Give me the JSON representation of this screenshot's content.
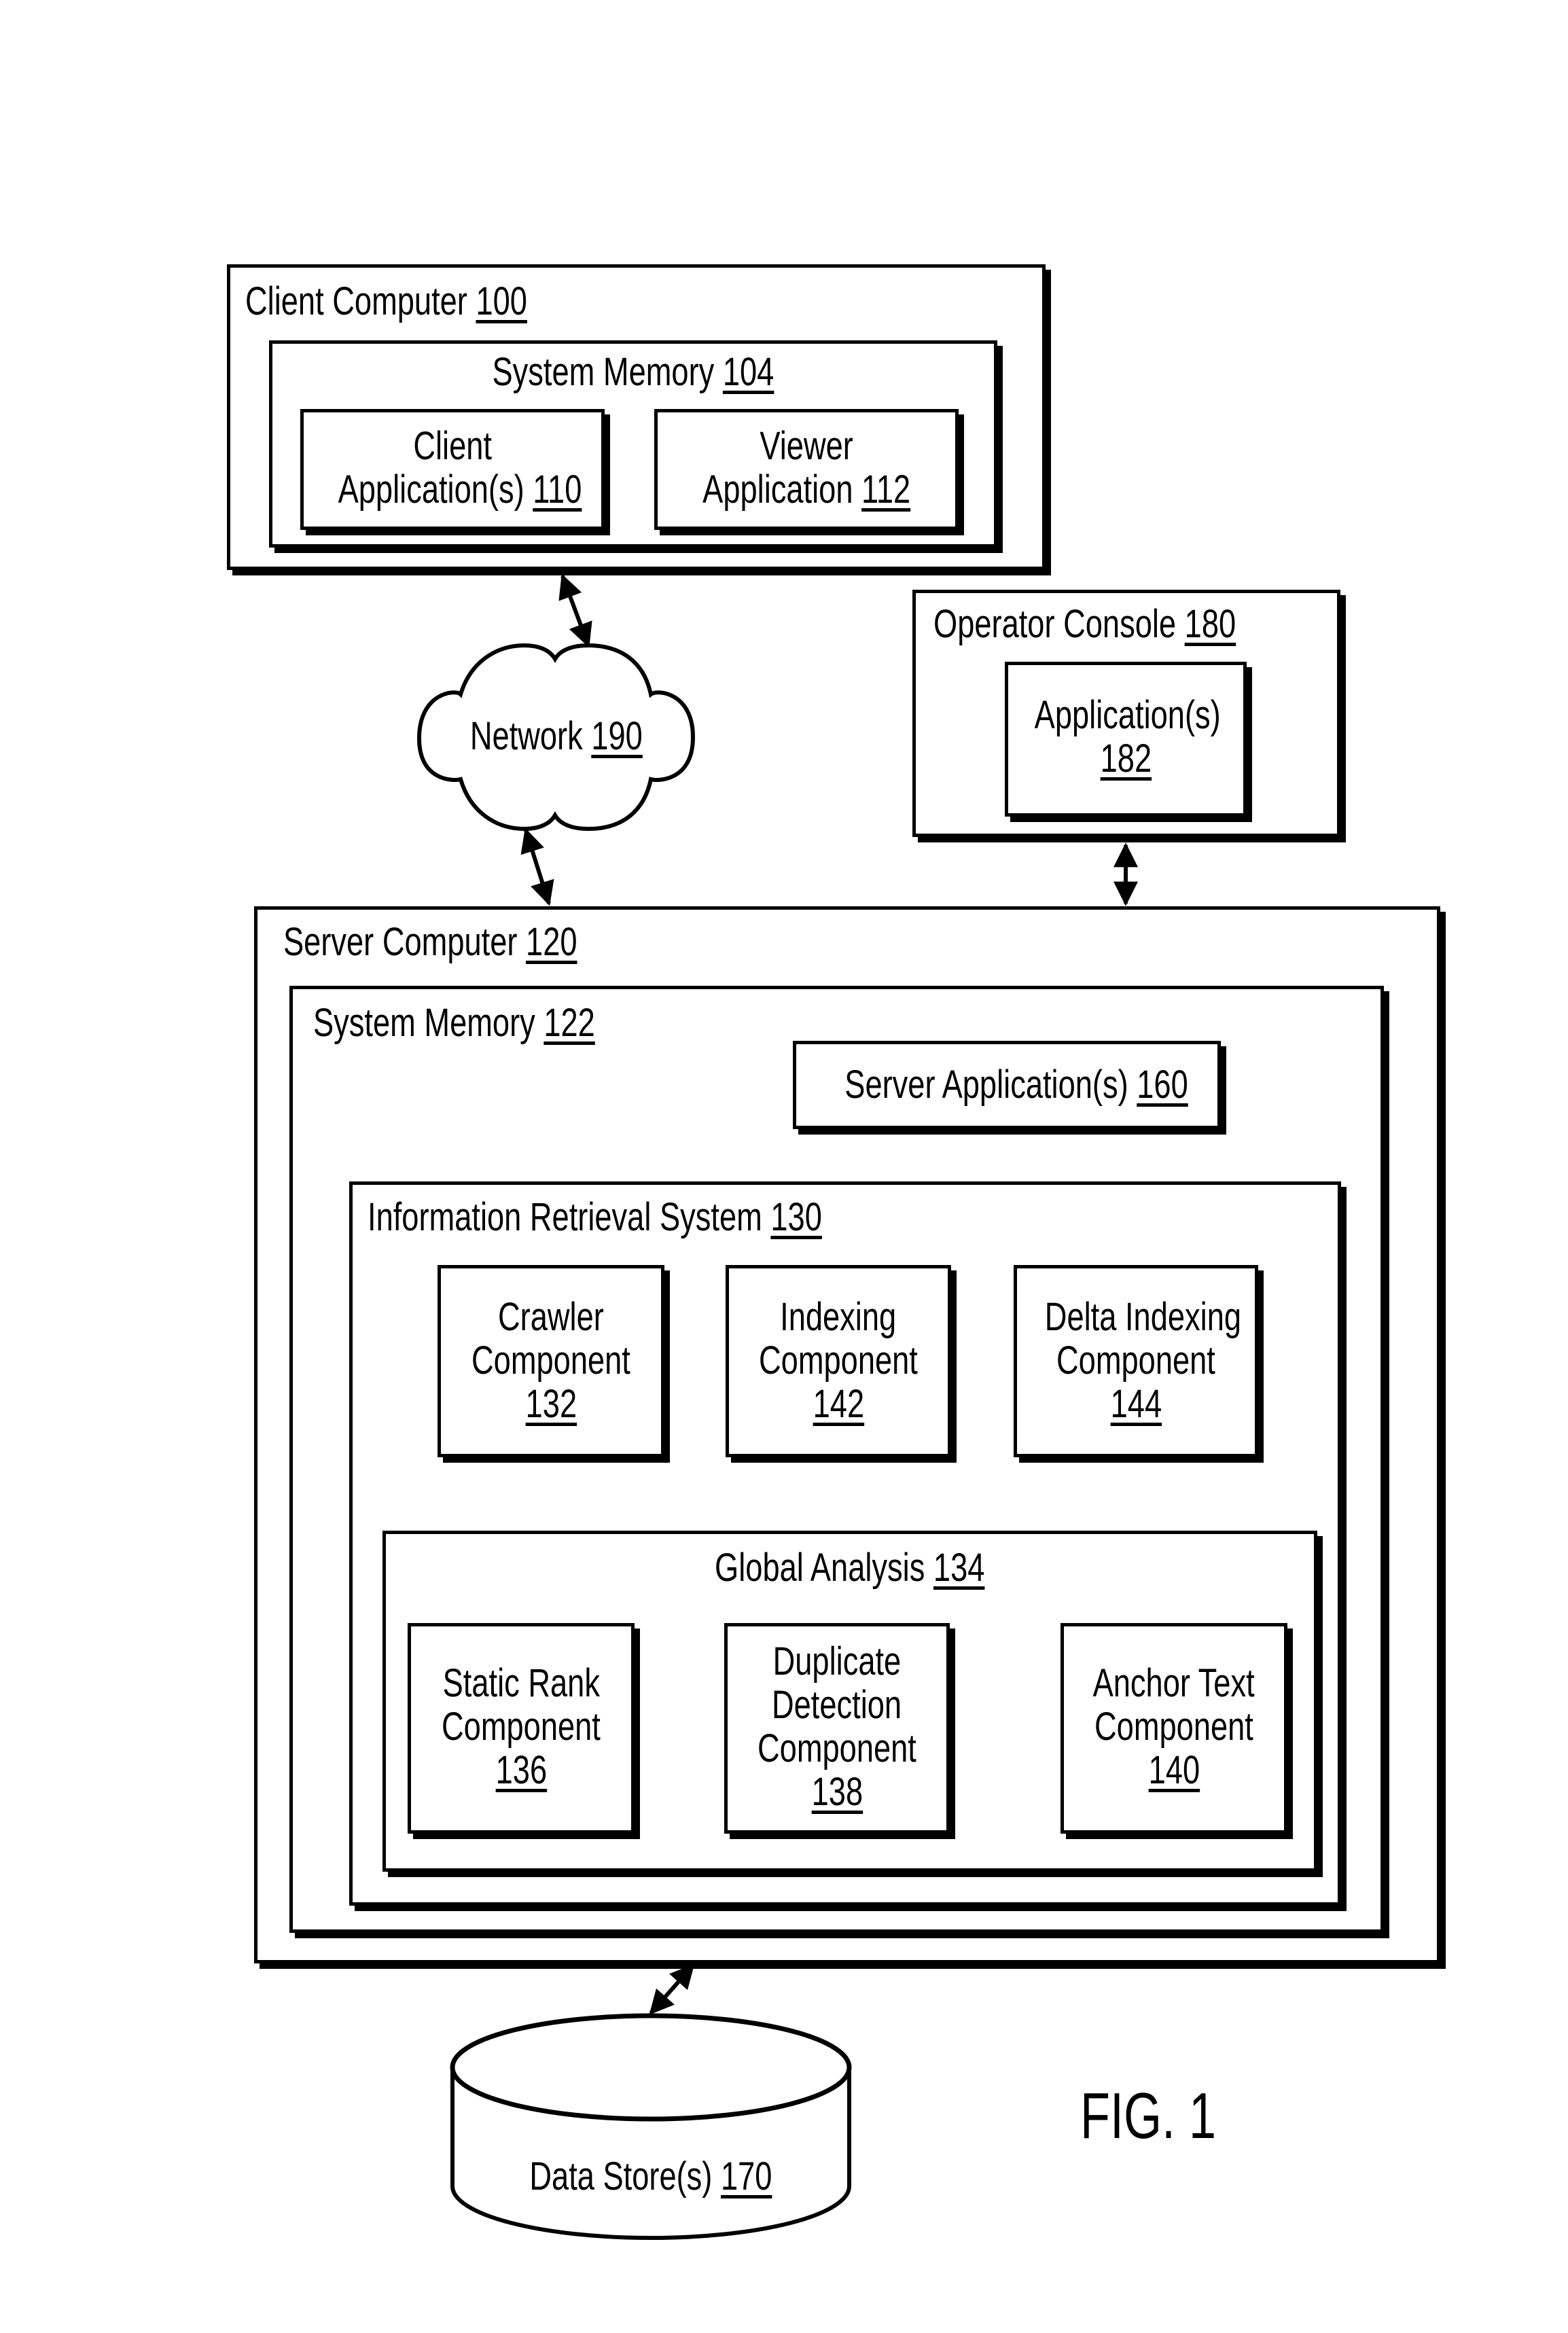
{
  "figure_label": "FIG. 1",
  "client_computer": {
    "title": "Client Computer",
    "ref": "100",
    "system_memory": {
      "title": "System Memory",
      "ref": "104",
      "client_app": {
        "line1": "Client",
        "line2": "Application(s)",
        "ref": "110"
      },
      "viewer_app": {
        "line1": "Viewer",
        "line2": "Application",
        "ref": "112"
      }
    }
  },
  "network": {
    "title": "Network",
    "ref": "190"
  },
  "operator_console": {
    "title": "Operator Console",
    "ref": "180",
    "applications": {
      "line1": "Application(s)",
      "ref": "182"
    }
  },
  "server_computer": {
    "title": "Server Computer",
    "ref": "120",
    "system_memory": {
      "title": "System Memory",
      "ref": "122",
      "server_apps": {
        "title": "Server Application(s)",
        "ref": "160"
      },
      "irs": {
        "title": "Information Retrieval System",
        "ref": "130",
        "crawler": {
          "line1": "Crawler",
          "line2": "Component",
          "ref": "132"
        },
        "indexing": {
          "line1": "Indexing",
          "line2": "Component",
          "ref": "142"
        },
        "delta_indexing": {
          "line1": "Delta Indexing",
          "line2": "Component",
          "ref": "144"
        },
        "global_analysis": {
          "title": "Global Analysis",
          "ref": "134",
          "static_rank": {
            "line1": "Static Rank",
            "line2": "Component",
            "ref": "136"
          },
          "duplicate_detection": {
            "line1": "Duplicate",
            "line2": "Detection",
            "line3": "Component",
            "ref": "138"
          },
          "anchor_text": {
            "line1": "Anchor Text",
            "line2": "Component",
            "ref": "140"
          }
        }
      }
    }
  },
  "data_store": {
    "title": "Data Store(s)",
    "ref": "170"
  }
}
